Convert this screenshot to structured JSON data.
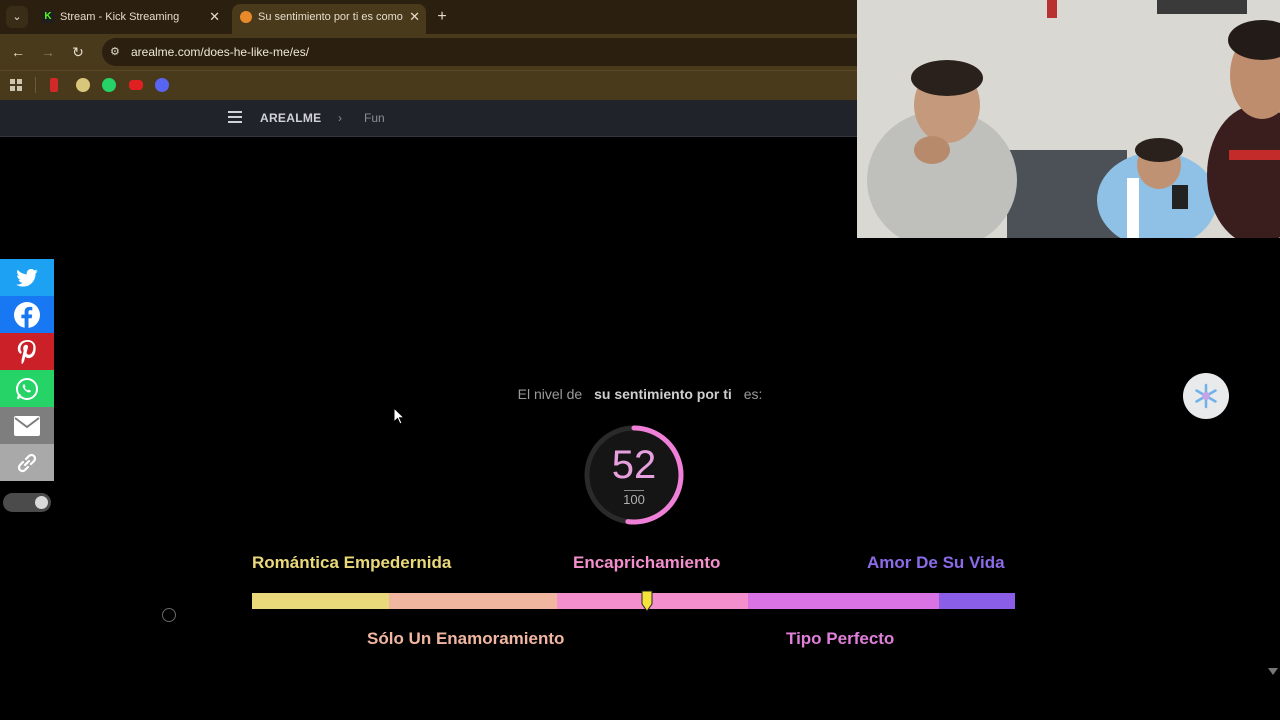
{
  "browser": {
    "tabs": [
      {
        "title": "Stream - Kick Streaming",
        "active": false,
        "favicon": "kick-logo"
      },
      {
        "title": "Su sentimiento por ti es como",
        "active": true,
        "favicon": "fox-logo"
      }
    ],
    "url": "arealme.com/does-he-like-me/es/"
  },
  "site": {
    "brand": "AREALME",
    "breadcrumb_sep": "›",
    "breadcrumb": "Fun"
  },
  "result": {
    "prefix": "El nivel de",
    "subject": "su sentimiento por ti",
    "suffix": "es:",
    "score": "52",
    "max": "100",
    "score_fraction": 0.52
  },
  "scale": {
    "top_labels": [
      "Romántica Empedernida",
      "Encaprichamiento",
      "Amor De Su Vida"
    ],
    "bottom_labels": [
      "Sólo Un Enamoramiento",
      "Tipo Perfecto"
    ],
    "marker_fraction": 0.52,
    "colors": [
      "#ead97a",
      "#f1b6a0",
      "#f28fcc",
      "#d972e2",
      "#8b5ee8"
    ]
  },
  "colors": {
    "accent_pink": "#e6a0dd",
    "label_yellow": "#ead97a",
    "label_peach": "#f1b6a0",
    "label_pink": "#f28fcc",
    "label_violet": "#8b6be8"
  }
}
